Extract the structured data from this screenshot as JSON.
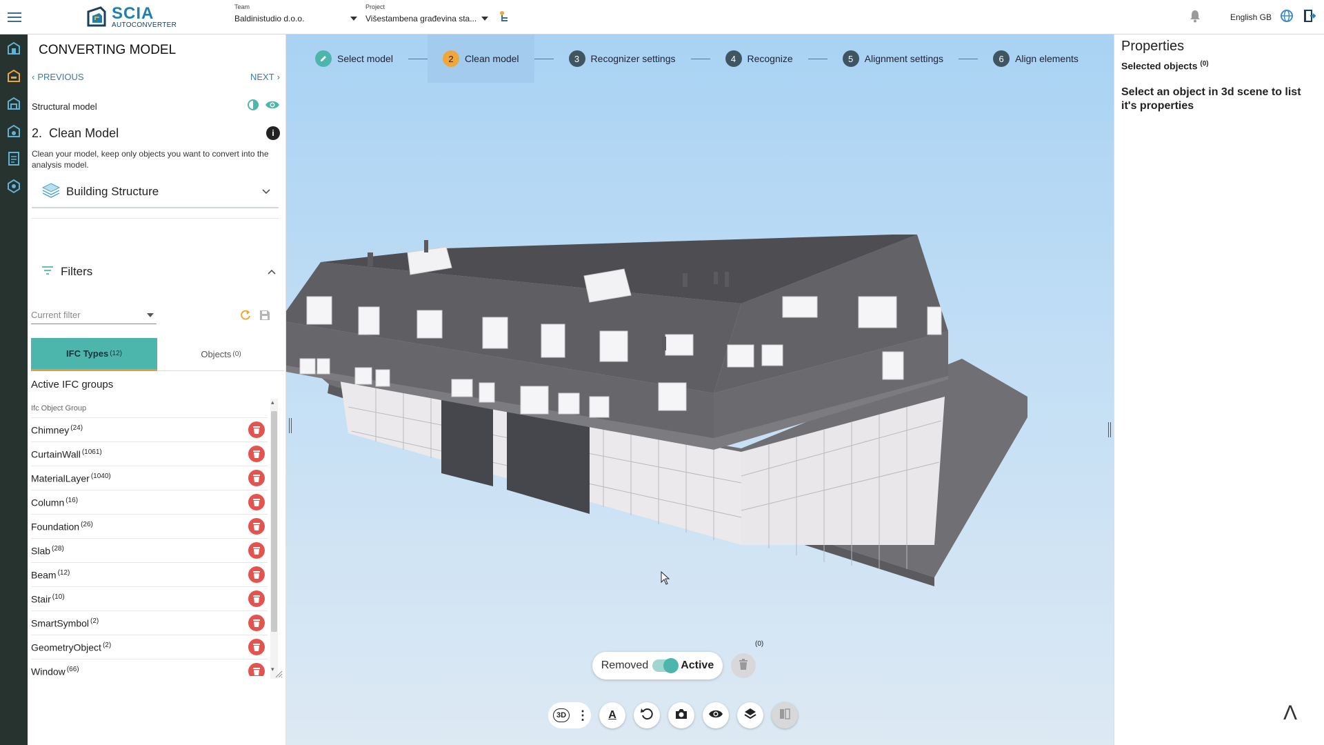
{
  "app": {
    "logo_main": "SCIA",
    "logo_sub": "AUTOCONVERTER"
  },
  "team": {
    "label": "Team",
    "value": "Baldinistudio d.o.o."
  },
  "project": {
    "label": "Project",
    "value": "Višestambena građevina sta..."
  },
  "topbar": {
    "language": "English GB"
  },
  "left": {
    "title": "CONVERTING MODEL",
    "previous": "PREVIOUS",
    "next": "NEXT",
    "model_label": "Structural model",
    "step_number": "2.",
    "step_title": "Clean Model",
    "step_desc": "Clean your model, keep only objects you want to convert into the analysis model.",
    "building_structure": "Building Structure",
    "filters": "Filters",
    "current_filter_placeholder": "Current filter",
    "tab_ifc": "IFC Types",
    "tab_ifc_count": "(12)",
    "tab_objects": "Objects",
    "tab_objects_count": "(0)",
    "active_groups": "Active IFC groups",
    "group_header": "Ifc Object Group",
    "items": [
      {
        "name": "Chimney",
        "count": "(24)"
      },
      {
        "name": "CurtainWall",
        "count": "(1061)"
      },
      {
        "name": "MaterialLayer",
        "count": "(1040)"
      },
      {
        "name": "Column",
        "count": "(16)"
      },
      {
        "name": "Foundation",
        "count": "(26)"
      },
      {
        "name": "Slab",
        "count": "(28)"
      },
      {
        "name": "Beam",
        "count": "(12)"
      },
      {
        "name": "Stair",
        "count": "(10)"
      },
      {
        "name": "SmartSymbol",
        "count": "(2)"
      },
      {
        "name": "GeometryObject",
        "count": "(2)"
      },
      {
        "name": "Window",
        "count": "(66)"
      }
    ]
  },
  "steps": [
    {
      "num": "",
      "label": "Select model",
      "state": "done"
    },
    {
      "num": "2",
      "label": "Clean model",
      "state": "active"
    },
    {
      "num": "3",
      "label": "Recognizer settings",
      "state": "todo"
    },
    {
      "num": "4",
      "label": "Recognize",
      "state": "todo"
    },
    {
      "num": "5",
      "label": "Alignment settings",
      "state": "todo"
    },
    {
      "num": "6",
      "label": "Align elements",
      "state": "todo"
    }
  ],
  "viewport": {
    "removed_label": "Removed",
    "active_label": "Active",
    "trash_count": "(0)",
    "toolbar_3d": "3D",
    "toolbar_text_icon": "A",
    "collapse": "Λ"
  },
  "properties": {
    "title": "Properties",
    "selected": "Selected objects",
    "selected_count": "(0)",
    "hint": "Select an object in 3d scene to list it's properties"
  },
  "colors": {
    "accent": "#4db6ac",
    "delete": "#e4544f",
    "rail": "#27332f",
    "link": "#3b79a6",
    "step_active": "#f0a73a"
  }
}
